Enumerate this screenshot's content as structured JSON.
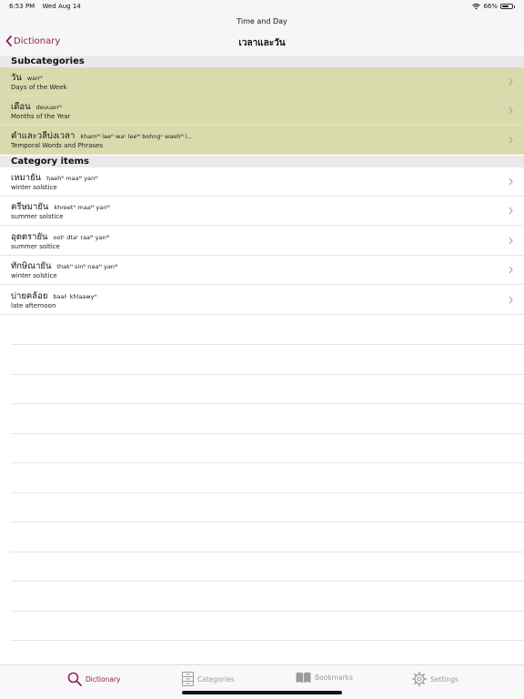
{
  "status": {
    "time": "6:53 PM",
    "date": "Wed Aug 14",
    "battery": "66%",
    "battery_level": 0.66
  },
  "window": {
    "title": "Time and Day"
  },
  "nav": {
    "back_label": "Dictionary",
    "title": "เวลาและวัน"
  },
  "colors": {
    "accent": "#8e1f5e",
    "subcategory_bg": "#d9dbad",
    "section_bg": "#e9e9eb"
  },
  "subcategories": {
    "header": "Subcategories",
    "items": [
      {
        "thai": "วัน",
        "roman": "wanᴹ",
        "english": "Days of the Week"
      },
      {
        "thai": "เดือน",
        "roman": "deuuanᴹ",
        "english": "Months of the Year"
      },
      {
        "thai": "คำและวลีบ่งเวลา",
        "roman": "khamᴹ laeᴴ waᴸ leeᴹ bohngᴸ waehᴹ l...",
        "english": "Temporal Words and Phrases"
      }
    ]
  },
  "category_items": {
    "header": "Category items",
    "items": [
      {
        "thai": "เหมายัน",
        "roman": "haehᴿ maaᴹ yanᴹ",
        "english": "winter solstice"
      },
      {
        "thai": "ครีษมายัน",
        "roman": "khreetᴴ maaᴹ yanᴹ",
        "english": "summer solstice"
      },
      {
        "thai": "อุตตรายัน",
        "roman": "ootᴸ dtaᴸ raaᴹ yanᴹ",
        "english": "summer soltice"
      },
      {
        "thai": "ทักษิณายัน",
        "roman": "thakᴴ sinᴿ naaᴹ yanᴹ",
        "english": "winter solstice"
      },
      {
        "thai": "บ่ายคล้อย",
        "roman": "baaiᴸ khlaawyᴴ",
        "english": "late afternoon"
      }
    ]
  },
  "tabs": [
    {
      "label": "Dictionary",
      "icon": "search-icon",
      "active": true
    },
    {
      "label": "Categories",
      "icon": "cabinet-icon",
      "active": false
    },
    {
      "label": "Bookmarks",
      "icon": "book-icon",
      "active": false
    },
    {
      "label": "Settings",
      "icon": "gear-icon",
      "active": false
    }
  ]
}
